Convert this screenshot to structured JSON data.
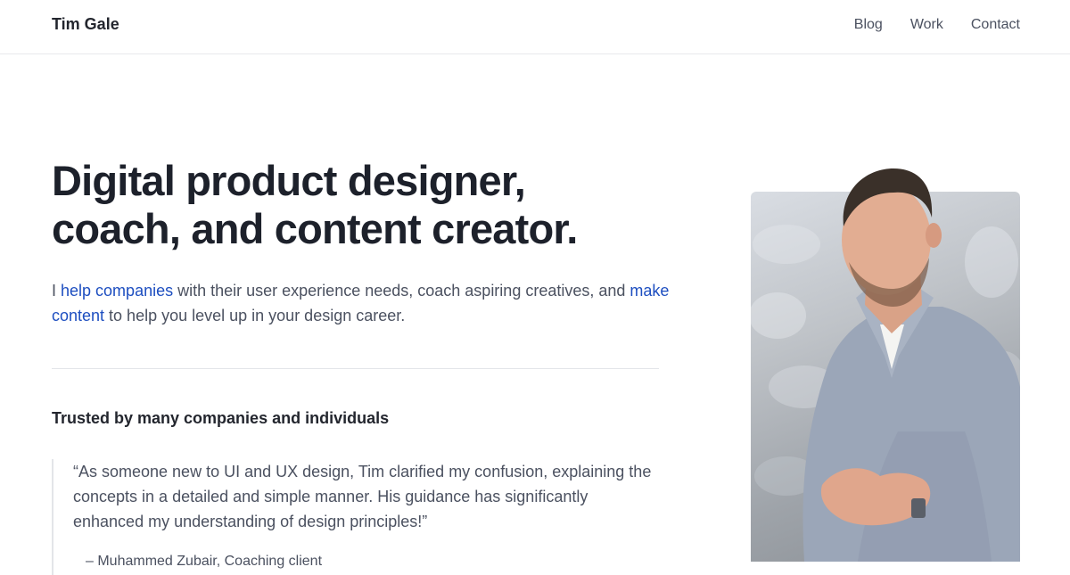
{
  "header": {
    "brand": "Tim Gale",
    "nav": [
      "Blog",
      "Work",
      "Contact"
    ]
  },
  "hero": {
    "title_line1": "Digital product designer,",
    "title_line2": "coach, and content creator.",
    "intro": {
      "part1": "I ",
      "link1": "help companies",
      "part2": " with their user experience needs, coach aspiring creatives, and ",
      "link2": "make content",
      "part3": " to help you level up in your design career."
    }
  },
  "testimonials": {
    "heading": "Trusted by many companies and individuals",
    "quote": "“As someone new to UI and UX design, Tim clarified my confusion, explaining the concepts in a detailed and simple manner. His guidance has significantly enhanced my understanding of design principles!”",
    "author": "– Muhammed Zubair, Coaching client"
  },
  "colors": {
    "link": "#1d4ec0",
    "text": "#4b5160",
    "heading": "#1d212b"
  }
}
